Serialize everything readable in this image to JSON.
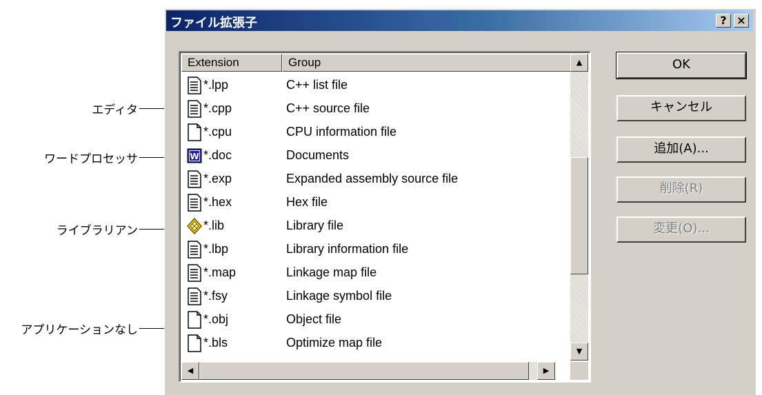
{
  "window": {
    "title": "ファイル拡張子",
    "help_label": "?",
    "close_label": "×"
  },
  "list": {
    "columns": [
      "Extension",
      "Group"
    ],
    "rows": [
      {
        "ext": "*.lpp",
        "group": "C++ list file",
        "icon": "text-document-icon"
      },
      {
        "ext": "*.cpp",
        "group": "C++ source file",
        "icon": "text-document-icon"
      },
      {
        "ext": "*.cpu",
        "group": "CPU information file",
        "icon": "blank-document-icon"
      },
      {
        "ext": "*.doc",
        "group": "Documents",
        "icon": "word-processor-icon"
      },
      {
        "ext": "*.exp",
        "group": "Expanded assembly source file",
        "icon": "text-document-icon"
      },
      {
        "ext": "*.hex",
        "group": "Hex file",
        "icon": "text-document-icon"
      },
      {
        "ext": "*.lib",
        "group": "Library file",
        "icon": "librarian-icon"
      },
      {
        "ext": "*.lbp",
        "group": "Library information file",
        "icon": "text-document-icon"
      },
      {
        "ext": "*.map",
        "group": "Linkage map file",
        "icon": "text-document-icon"
      },
      {
        "ext": "*.fsy",
        "group": "Linkage symbol file",
        "icon": "text-document-icon"
      },
      {
        "ext": "*.obj",
        "group": "Object file",
        "icon": "blank-document-icon"
      },
      {
        "ext": "*.bls",
        "group": "Optimize map file",
        "icon": "blank-document-icon"
      }
    ]
  },
  "buttons": {
    "ok": "OK",
    "cancel": "キャンセル",
    "add": "追加(A)...",
    "delete": "削除(R)",
    "change": "変更(O)..."
  },
  "callouts": {
    "editor": "エディタ",
    "word_processor": "ワードプロセッサ",
    "librarian": "ライブラリアン",
    "no_application": "アプリケーションなし"
  }
}
